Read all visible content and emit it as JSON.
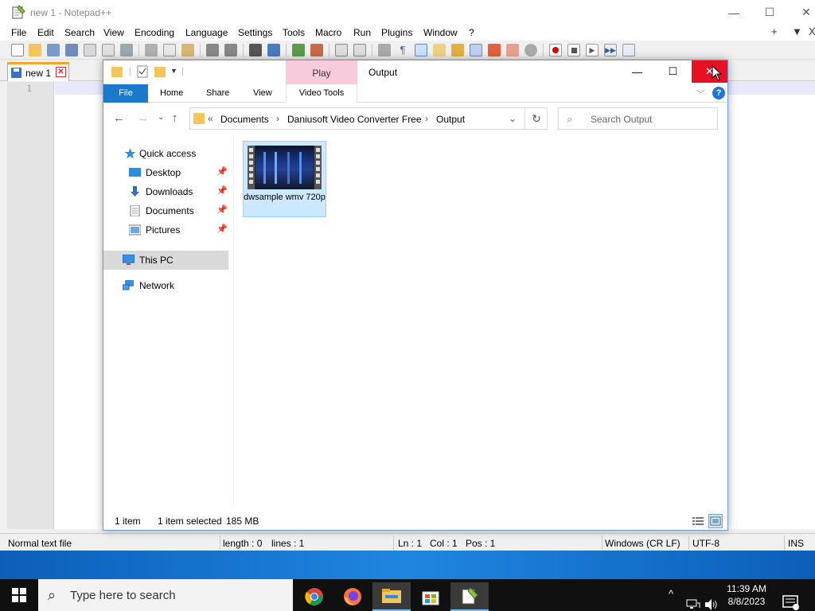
{
  "notepad": {
    "title": "new 1 - Notepad++",
    "menu": [
      "File",
      "Edit",
      "Search",
      "View",
      "Encoding",
      "Language",
      "Settings",
      "Tools",
      "Macro",
      "Run",
      "Plugins",
      "Window",
      "?"
    ],
    "menu_right": [
      "+",
      "▼",
      "X"
    ],
    "tab_label": "new 1",
    "line_number": "1",
    "status": {
      "file_type": "Normal text file",
      "length": "length : 0",
      "lines": "lines : 1",
      "ln": "Ln : 1",
      "col": "Col : 1",
      "pos": "Pos : 1",
      "eol": "Windows (CR LF)",
      "encoding": "UTF-8",
      "mode": "INS"
    }
  },
  "explorer": {
    "title": "Output",
    "context_tab": "Play",
    "ribbon_tabs": [
      "File",
      "Home",
      "Share",
      "View",
      "Video Tools"
    ],
    "breadcrumb": [
      "Documents",
      "Daniusoft Video Converter Free",
      "Output"
    ],
    "breadcrumb_overflow": "«",
    "search_placeholder": "Search Output",
    "sidebar": {
      "quick_access": "Quick access",
      "pinned": [
        "Desktop",
        "Downloads",
        "Documents",
        "Pictures"
      ],
      "this_pc": "This PC",
      "network": "Network"
    },
    "file": {
      "name": "dwsample wmv 720p"
    },
    "status": {
      "count": "1 item",
      "selection": "1 item selected",
      "size": "185 MB"
    }
  },
  "taskbar": {
    "search_placeholder": "Type here to search",
    "time": "11:39 AM",
    "date": "8/8/2023"
  },
  "colors": {
    "explorer_accent": "#1979ca",
    "close_hover": "#e81123",
    "selection": "#cce8ff",
    "context_tab": "#f8cbdc"
  }
}
